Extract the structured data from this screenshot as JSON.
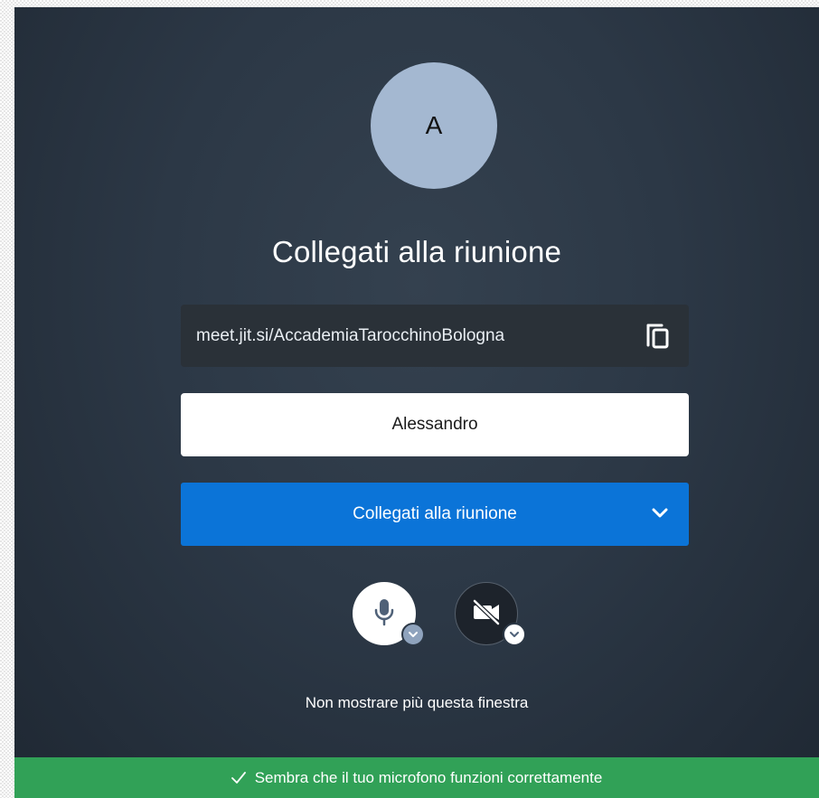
{
  "avatar": {
    "initial": "A"
  },
  "prejoin": {
    "title": "Collegati alla riunione",
    "meeting_url": "meet.jit.si/AccademiaTarocchinoBologna",
    "copy_icon": "copy-icon",
    "name_value": "Alessandro",
    "join_label": "Collegati alla riunione",
    "join_options_icon": "chevron-down-icon",
    "mic_icon": "microphone-icon",
    "camera_icon": "camera-off-icon",
    "dont_show_label": "Non mostrare più questa finestra"
  },
  "status": {
    "icon": "checkmark-icon",
    "message": "Sembra che il tuo microfono funzioni correttamente"
  },
  "colors": {
    "background": "#2c3846",
    "avatar": "#a4b8d1",
    "url_box": "#2a3138",
    "join_button": "#0b74d8",
    "status_bar": "#31a157"
  }
}
